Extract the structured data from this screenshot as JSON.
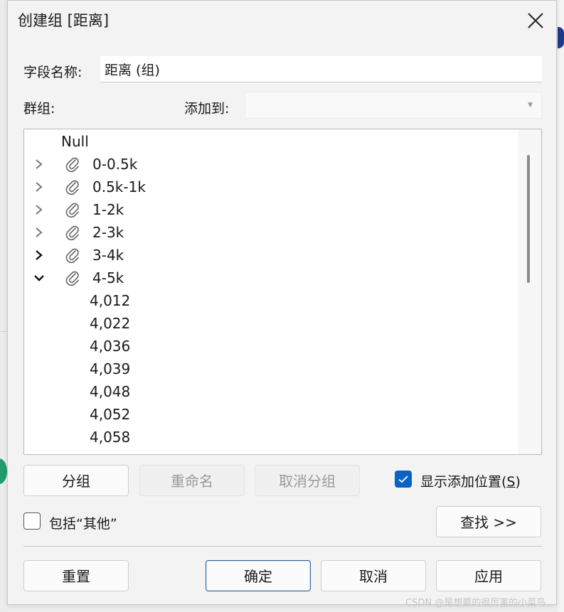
{
  "dialog": {
    "title": "创建组 [距离]"
  },
  "form": {
    "field_name_label": "字段名称:",
    "field_name_value": "距离 (组)",
    "groups_label": "群组:",
    "add_to_label": "添加到:",
    "add_to_value": ""
  },
  "tree": {
    "null_label": "Null",
    "groups": [
      {
        "label": "0-0.5k",
        "expanded": false
      },
      {
        "label": "0.5k-1k",
        "expanded": false
      },
      {
        "label": "1-2k",
        "expanded": false
      },
      {
        "label": "2-3k",
        "expanded": false
      },
      {
        "label": "3-4k",
        "expanded": false
      },
      {
        "label": "4-5k",
        "expanded": true
      }
    ],
    "children": [
      "4,012",
      "4,022",
      "4,036",
      "4,039",
      "4,048",
      "4,052",
      "4,058"
    ]
  },
  "buttons": {
    "group": "分组",
    "rename": "重命名",
    "ungroup": "取消分组",
    "find": "查找 >>",
    "reset": "重置",
    "ok": "确定",
    "cancel": "取消",
    "apply": "应用"
  },
  "options": {
    "show_add_location_prefix": "显示添加位置(",
    "show_add_location_mnemonic": "S",
    "show_add_location_suffix": ")",
    "show_add_location_checked": true,
    "include_other_label": "包括“其他”",
    "include_other_checked": false
  },
  "watermark": "CSDN @是想要的很厉害的小菜鸟",
  "colors": {
    "accent": "#0a62c4",
    "primary_border": "#2f5f99"
  },
  "icons": {
    "close": "close-icon",
    "expand": "chevron-right-icon",
    "collapse": "chevron-down-icon",
    "group": "paperclip-icon",
    "check": "checkmark-icon",
    "dropdown": "dropdown-caret-icon"
  }
}
